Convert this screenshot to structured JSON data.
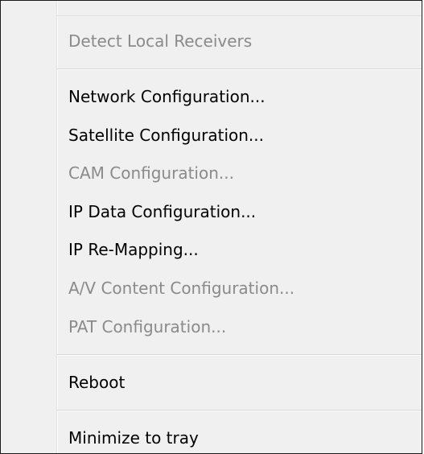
{
  "menu": {
    "items": [
      {
        "label": "Detect Local Receivers",
        "enabled": false
      },
      {
        "label": "Network Configuration...",
        "enabled": true
      },
      {
        "label": "Satellite Configuration...",
        "enabled": true
      },
      {
        "label": "CAM Configuration...",
        "enabled": false
      },
      {
        "label": "IP Data Configuration...",
        "enabled": true
      },
      {
        "label": "IP Re-Mapping...",
        "enabled": true
      },
      {
        "label": "A/V Content Configuration...",
        "enabled": false
      },
      {
        "label": "PAT Configuration...",
        "enabled": false
      },
      {
        "label": "Reboot",
        "enabled": true
      },
      {
        "label": "Minimize to tray",
        "enabled": true
      }
    ]
  },
  "colors": {
    "enabled_text": "#000000",
    "disabled_text": "#8a8a8a",
    "menu_background": "#f0f0f0"
  }
}
